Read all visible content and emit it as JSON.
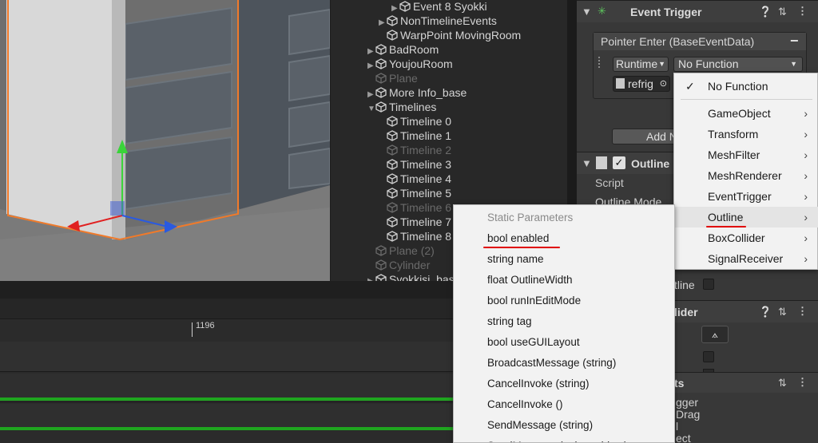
{
  "hierarchy": {
    "items": [
      {
        "label": "Event 8 Syokki",
        "dim": false,
        "arrow": "▶"
      },
      {
        "label": "NonTimelineEvents",
        "dim": false,
        "arrow": "▶"
      },
      {
        "label": "WarpPoint MovingRoom",
        "dim": false,
        "arrow": ""
      },
      {
        "label": "BadRoom",
        "dim": false,
        "arrow": "▶"
      },
      {
        "label": "YoujouRoom",
        "dim": false,
        "arrow": "▶"
      },
      {
        "label": "Plane",
        "dim": true,
        "arrow": ""
      },
      {
        "label": "More Info_base",
        "dim": false,
        "arrow": "▶"
      },
      {
        "label": "Timelines",
        "dim": false,
        "arrow": "▼"
      },
      {
        "label": "Timeline 0",
        "dim": false,
        "arrow": ""
      },
      {
        "label": "Timeline 1",
        "dim": false,
        "arrow": ""
      },
      {
        "label": "Timeline 2",
        "dim": true,
        "arrow": ""
      },
      {
        "label": "Timeline 3",
        "dim": false,
        "arrow": ""
      },
      {
        "label": "Timeline 4",
        "dim": false,
        "arrow": ""
      },
      {
        "label": "Timeline 5",
        "dim": false,
        "arrow": ""
      },
      {
        "label": "Timeline 6",
        "dim": true,
        "arrow": ""
      },
      {
        "label": "Timeline 7",
        "dim": false,
        "arrow": ""
      },
      {
        "label": "Timeline 8",
        "dim": false,
        "arrow": ""
      },
      {
        "label": "Plane (2)",
        "dim": true,
        "arrow": ""
      },
      {
        "label": "Cylinder",
        "dim": true,
        "arrow": ""
      },
      {
        "label": "Syokkisi_base",
        "dim": false,
        "arrow": "▶"
      }
    ]
  },
  "timeline": {
    "marker_label": "1196"
  },
  "inspector": {
    "event_trigger_title": "Event Trigger",
    "pointer_enter_label": "Pointer Enter (BaseEventData)",
    "remove_label": "−",
    "runtime_value": "Runtime",
    "function_value": "No Function",
    "object_value": "refrig",
    "add_new_label": "Add N",
    "outline_title": "Outline",
    "script_label": "Script",
    "outline_mode_label": "Outline Mode",
    "outline_toggle_label": "tline",
    "collider_title": "lider",
    "events_label": "ts",
    "event_rows": [
      "gger",
      "Drag",
      "l",
      "ect"
    ]
  },
  "function_menu": {
    "items": [
      {
        "label": "No Function",
        "checked": true,
        "submenu": false
      },
      {
        "label": "GameObject",
        "checked": false,
        "submenu": true
      },
      {
        "label": "Transform",
        "checked": false,
        "submenu": true
      },
      {
        "label": "MeshFilter",
        "checked": false,
        "submenu": true
      },
      {
        "label": "MeshRenderer",
        "checked": false,
        "submenu": true
      },
      {
        "label": "EventTrigger",
        "checked": false,
        "submenu": true
      },
      {
        "label": "Outline",
        "checked": false,
        "submenu": true,
        "underlined": true
      },
      {
        "label": "BoxCollider",
        "checked": false,
        "submenu": true
      },
      {
        "label": "SignalReceiver",
        "checked": false,
        "submenu": true
      }
    ]
  },
  "param_menu": {
    "header": "Static Parameters",
    "items": [
      "bool enabled",
      "string name",
      "float OutlineWidth",
      "bool runInEditMode",
      "string tag",
      "bool useGUILayout",
      "BroadcastMessage (string)",
      "CancelInvoke (string)",
      "CancelInvoke ()",
      "SendMessage (string)",
      "SendMessage (string, object)"
    ]
  },
  "colors": {
    "highlight_underline": "#e00000",
    "timeline_green": "#1fa51f",
    "selection_orange": "#f07a2a"
  }
}
